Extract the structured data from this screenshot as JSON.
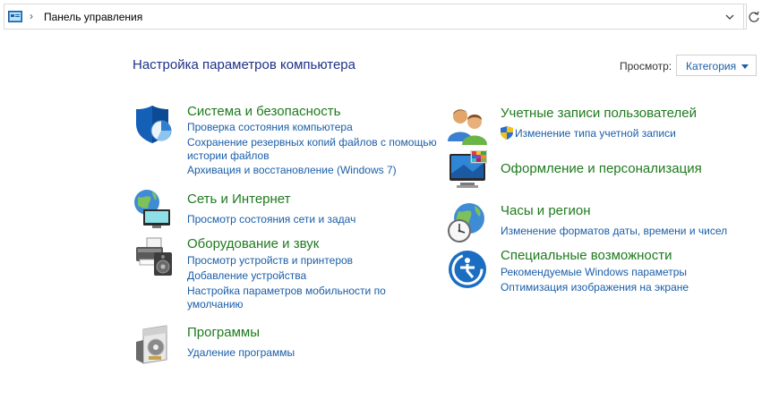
{
  "address_bar": {
    "path": "Панель управления"
  },
  "header": {
    "title": "Настройка параметров компьютера",
    "view_label": "Просмотр:",
    "view_value": "Категория"
  },
  "categories": {
    "system": {
      "title": "Система и безопасность",
      "links": [
        "Проверка состояния компьютера",
        "Сохранение резервных копий файлов с помощью",
        "истории файлов",
        "Архивация и восстановление (Windows 7)"
      ]
    },
    "network": {
      "title": "Сеть и Интернет",
      "links": [
        "Просмотр состояния сети и задач"
      ]
    },
    "hardware": {
      "title": "Оборудование и звук",
      "links": [
        "Просмотр устройств и принтеров",
        "Добавление устройства",
        "Настройка параметров мобильности по",
        "умолчанию"
      ]
    },
    "programs": {
      "title": "Программы",
      "links": [
        "Удаление программы"
      ]
    },
    "users": {
      "title": "Учетные записи пользователей",
      "links": [
        "Изменение типа учетной записи"
      ]
    },
    "appearance": {
      "title": "Оформление и персонализация",
      "links": []
    },
    "clock": {
      "title": "Часы и регион",
      "links": [
        "Изменение форматов даты, времени и чисел"
      ]
    },
    "access": {
      "title": "Специальные возможности",
      "links": [
        "Рекомендуемые Windows параметры",
        "Оптимизация изображения на экране"
      ]
    }
  },
  "icons": {
    "address_bar": "control-panel-icon",
    "system": "shield-icon",
    "network": "globe-network-icon",
    "hardware": "printer-icon",
    "programs": "programs-box-icon",
    "users": "users-icon",
    "appearance": "monitor-palette-icon",
    "clock": "globe-clock-icon",
    "access": "accessibility-icon",
    "uac": "uac-shield-icon"
  },
  "colors": {
    "category_title": "#1e7a1e",
    "link": "#1a5ea8",
    "page_title": "#1e3287"
  }
}
